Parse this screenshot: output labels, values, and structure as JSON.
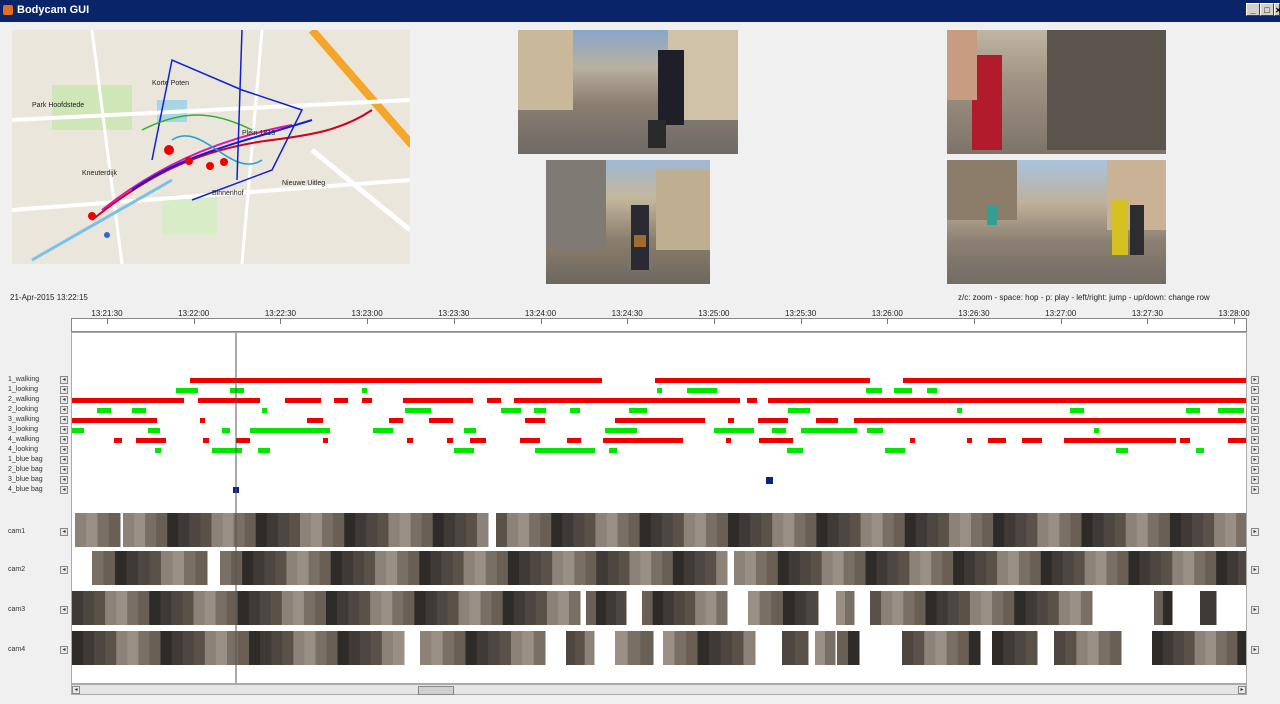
{
  "window": {
    "title": "Bodycam GUI",
    "min": "_",
    "max": "□",
    "close": "✕"
  },
  "datetime": "21-Apr-2015 13:22:15",
  "help": "z/c: zoom - space: hop - p: play - left/right: jump - up/down: change row",
  "map": {
    "labels": [
      "Park Hoofdstede",
      "Korte Poten",
      "Plein 1813",
      "Nieuwe Uitleg",
      "Binnenhof",
      "Kneuterdijk"
    ]
  },
  "timeline": {
    "ticks": [
      "13:21:30",
      "13:22:00",
      "13:22:30",
      "13:23:00",
      "13:23:30",
      "13:24:00",
      "13:24:30",
      "13:25:00",
      "13:25:30",
      "13:26:00",
      "13:26:30",
      "13:27:00",
      "13:27:30",
      "13:28:00"
    ]
  },
  "rows": [
    "1_walking",
    "1_looking",
    "2_walking",
    "2_looking",
    "3_walking",
    "3_looking",
    "4_walking",
    "4_looking",
    "1_blue bag",
    "2_blue bag",
    "3_blue bag",
    "4_blue bag"
  ],
  "cams": [
    "cam1",
    "cam2",
    "cam3",
    "cam4"
  ],
  "btn_left": "◂",
  "btn_right": "▸",
  "colors": {
    "walking": "#ee0000",
    "looking": "#00e600",
    "bag": "#0a1f8c",
    "title": "#0a246a"
  }
}
